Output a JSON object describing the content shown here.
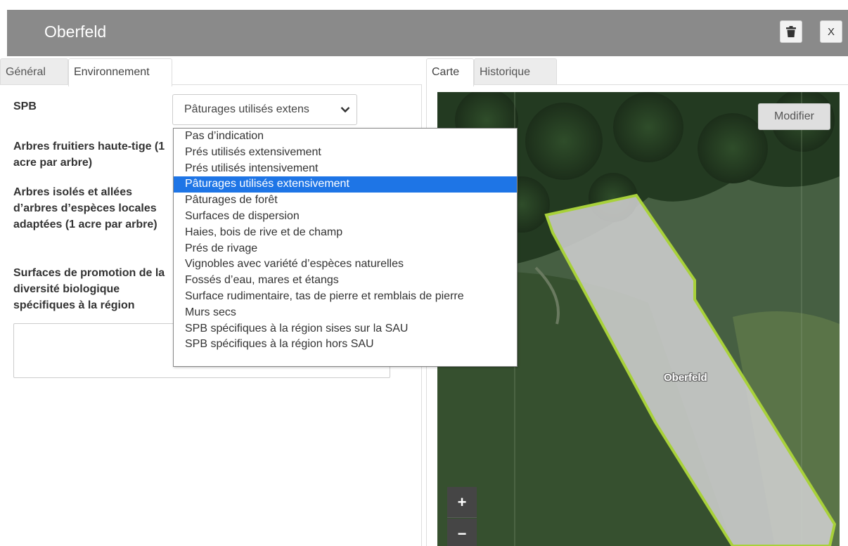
{
  "header": {
    "title": "Oberfeld",
    "close_label": "X",
    "delete_icon": "trash-icon"
  },
  "left_tabs": [
    {
      "label": "Général"
    },
    {
      "label": "Environnement"
    }
  ],
  "right_tabs": [
    {
      "label": "Carte"
    },
    {
      "label": "Historique"
    }
  ],
  "form": {
    "spb_label": "SPB",
    "spb_selected": "Pâturages utilisés extens",
    "fruit_trees_label": "Arbres fruitiers haute-tige (1 acre par arbre)",
    "isolated_trees_label": "Arbres isolés et allées d’arbres d’espèces locales adaptées (1 acre par arbre)",
    "regional_surfaces_label": "Surfaces de promotion de la diversité biologique spécifiques à la région"
  },
  "spb_options": [
    "Pas d’indication",
    "Prés utilisés extensivement",
    "Prés utilisés intensivement",
    "Pâturages utilisés extensivement",
    "Pâturages de forêt",
    "Surfaces de dispersion",
    "Haies, bois de rive et de champ",
    "Prés de rivage",
    "Vignobles avec variété d’espèces naturelles",
    "Fossés d’eau, mares et étangs",
    "Surface rudimentaire, tas de pierre et remblais de pierre",
    "Murs secs",
    "SPB spécifiques à la région sises sur la SAU",
    "SPB spécifiques à la région hors SAU"
  ],
  "spb_selected_index": 3,
  "map": {
    "modify_label": "Modifier",
    "field_name": "Oberfeld",
    "zoom_in": "+",
    "zoom_out": "−"
  },
  "colors": {
    "header_bg": "#8a8a8a",
    "selection": "#1e75e6",
    "field_outline": "#a8d13a"
  }
}
